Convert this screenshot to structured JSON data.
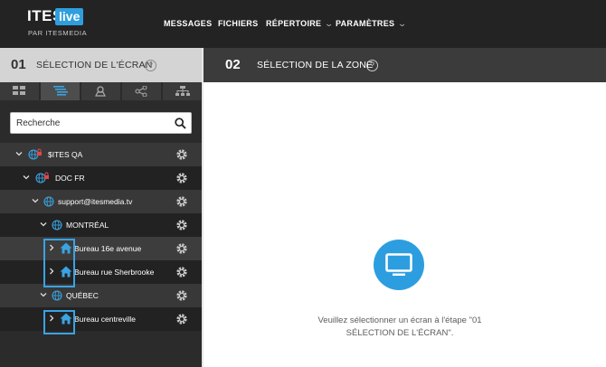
{
  "brand": {
    "name": "ITES",
    "badge": "live",
    "sub": "PAR ITESMEDIA"
  },
  "nav": {
    "messages": "MESSAGES",
    "files": "FICHIERS",
    "directory": "RÉPERTOIRE",
    "settings": "PARAMÈTRES"
  },
  "step1": {
    "number": "01",
    "label": "SÉLECTION DE L'ÉCRAN",
    "help": "?"
  },
  "step2": {
    "number": "02",
    "label": "SÉLECTION DE LA ZONE",
    "help": "?"
  },
  "tabs": [
    {
      "icon": "grid-icon",
      "active": false
    },
    {
      "icon": "list-tree-icon",
      "active": true
    },
    {
      "icon": "location-pin-icon",
      "active": false
    },
    {
      "icon": "share-icon",
      "active": false
    },
    {
      "icon": "hierarchy-icon",
      "active": false
    }
  ],
  "search": {
    "placeholder": "Recherche",
    "value": ""
  },
  "tree": [
    {
      "label": "$ITES QA",
      "icon": "globe-lock-icon"
    },
    {
      "label": "DOC FR",
      "icon": "globe-lock-icon"
    },
    {
      "label": "support@itesmedia.tv",
      "icon": "globe-icon"
    },
    {
      "label": "MONTRÉAL",
      "icon": "globe-icon"
    },
    {
      "label": "Bureau 16e avenue",
      "icon": "home-icon"
    },
    {
      "label": "Bureau rue Sherbrooke",
      "icon": "home-icon"
    },
    {
      "label": "QUÉBEC",
      "icon": "globe-icon"
    },
    {
      "label": "Bureau centreville",
      "icon": "home-icon"
    }
  ],
  "empty_state": {
    "icon": "monitor-icon",
    "message_line1": "Veuillez sélectionner un écran à l'étape \"01",
    "message_line2": "SÉLECTION DE L'ÉCRAN\"."
  },
  "colors": {
    "accent": "#2c9ee0",
    "topbar": "#232323",
    "panel": "#2b2b2b"
  }
}
